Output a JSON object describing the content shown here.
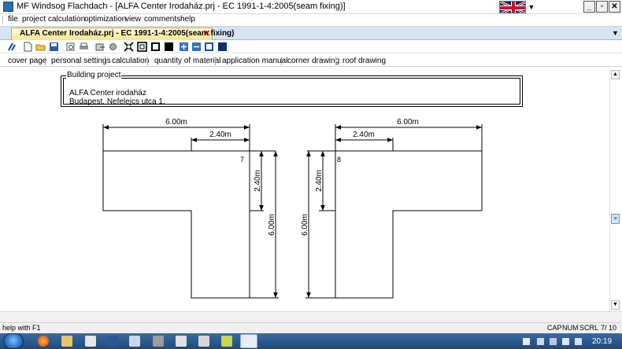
{
  "window": {
    "title": "MF Windsog Flachdach - [ALFA Center Irodaház.prj  -  EC 1991-1-4:2005(seam fixing)]",
    "minimize_glyph": "_",
    "maximize_glyph": "▫",
    "close_glyph": "✕"
  },
  "menu": {
    "items": [
      "file",
      "project",
      "calculation",
      "optimization",
      "view",
      "comments",
      "help"
    ]
  },
  "document_tab": {
    "label": "ALFA Center Irodaház.prj  -  EC 1991-1-4:2005(seam fixing)",
    "close_glyph": "✕"
  },
  "sections": [
    "cover page",
    "personal settings",
    "calculation",
    "quantity of material",
    "application manual",
    "corner drawing",
    "roof drawing"
  ],
  "project_box": {
    "legend": "Building project",
    "name": "ALFA Center irodaház",
    "address": "Budapest, Nefelejcs utca 1."
  },
  "drawing": {
    "left": {
      "top_total": "6.00m",
      "top_inner": "2.40m",
      "vert_short": "2.40m",
      "vert_long": "6.00m",
      "corner_id": "7"
    },
    "right": {
      "top_total": "6.00m",
      "top_inner": "2.40m",
      "vert_short": "2.40m",
      "vert_long": "6.00m",
      "corner_id": "8"
    }
  },
  "status": {
    "help": "help with F1",
    "cap": "CAP",
    "num": "NUM",
    "scrl": "SCRL",
    "page": "7/ 10"
  },
  "taskbar": {
    "clock": "20:19"
  },
  "colors": {
    "tab_strip": "#d7e4f2",
    "doc_tab": "#ffe38a",
    "taskbar": "#1f4a7c"
  }
}
